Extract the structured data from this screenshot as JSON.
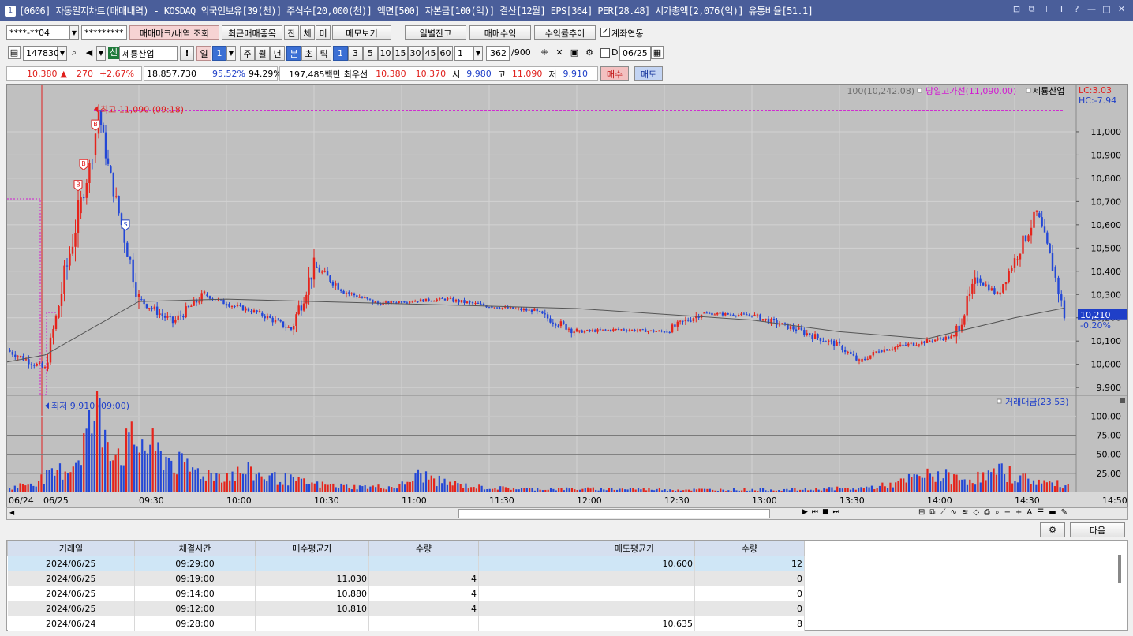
{
  "window": {
    "title": "[0606] 자동일지차트(매매내역) - KOSDAQ 외국인보유[39(천)] 주식수[20,000(천)] 액면[500] 자본금[100(억)] 결산[12월] EPS[364] PER[28.48] 시가총액[2,076(억)] 유통비율[51.1]",
    "icon_label": "1"
  },
  "toolbar1": {
    "account": "****-**04",
    "password": "*********",
    "trade_mark_btn": "매매마크/내역 조회",
    "recent_btn": "최근매매종목",
    "tab_jan": "잔",
    "tab_che": "체",
    "tab_mi": "미",
    "memo_btn": "메모보기",
    "daily_balance_btn": "일별잔고",
    "profit_btn": "매매수익",
    "profit_trend_btn": "수익률추이",
    "link_label": "계좌연동",
    "link_checked": "✓"
  },
  "toolbar2": {
    "code": "147830",
    "badge": "신",
    "stock_name": "제룡산업",
    "alert": "!",
    "period_day": "일",
    "period_num": "1",
    "period_week": "주",
    "period_month": "월",
    "period_year": "년",
    "period_min": "분",
    "period_sec": "초",
    "period_tick": "틱",
    "minute_options": [
      "1",
      "3",
      "5",
      "10",
      "15",
      "30",
      "45",
      "60"
    ],
    "interval_value": "1",
    "count": "362",
    "count_max": "/900",
    "date_check_label": "D",
    "date": "06/25"
  },
  "quote": {
    "price": "10,380",
    "arrow": "▲",
    "change": "270",
    "change_pct": "+2.67%",
    "volume": "18,857,730",
    "pct1": "95.52%",
    "pct2": "94.29%",
    "amount": "197,485백만",
    "best_label": "최우선",
    "best_ask": "10,380",
    "best_bid": "10,370",
    "open_label": "시",
    "open": "9,980",
    "high_label": "고",
    "high": "11,090",
    "low_label": "저",
    "low": "9,910",
    "buy_btn": "매수",
    "sell_btn": "매도"
  },
  "chart_data": {
    "type": "line",
    "title": "",
    "legend": {
      "ma": "100(10,242.08)",
      "high_line": "당일고가선(11,090.00)",
      "name": "제룡산업",
      "lc": "LC:3.03",
      "hc": "HC:-7.94"
    },
    "annotations": {
      "high": "최고 11,090 (09:18)",
      "low": "최저 9,910 (09:00)"
    },
    "trade_marks": [
      "B",
      "B",
      "B",
      "S"
    ],
    "current_price_tag": "10,210",
    "current_pct_tag": "-0.20%",
    "y_ticks": [
      "11,000",
      "10,900",
      "10,800",
      "10,700",
      "10,600",
      "10,500",
      "10,400",
      "10,300",
      "10,200",
      "10,100",
      "10,000",
      "9,900"
    ],
    "y_values": [
      11000,
      10900,
      10800,
      10700,
      10600,
      10500,
      10400,
      10300,
      10200,
      10100,
      10000,
      9900
    ],
    "ylim": [
      9870,
      11200
    ],
    "x_ticks": [
      "06/24",
      "06/25",
      "09:30",
      "10:00",
      "10:30",
      "11:00",
      "11:30",
      "12:00",
      "12:30",
      "13:00",
      "13:30",
      "14:00",
      "14:30",
      "14:50:00"
    ],
    "series": [
      {
        "name": "가격",
        "x": [
          "06/24",
          "06/25 09:00",
          "09:05",
          "09:10",
          "09:15",
          "09:18",
          "09:22",
          "09:25",
          "09:30",
          "09:40",
          "09:50",
          "10:00",
          "10:15",
          "10:25",
          "10:30",
          "10:40",
          "10:50",
          "11:00",
          "11:15",
          "11:30",
          "11:45",
          "12:00",
          "12:15",
          "12:30",
          "12:45",
          "13:00",
          "13:15",
          "13:30",
          "13:40",
          "13:50",
          "14:00",
          "14:10",
          "14:20",
          "14:25",
          "14:30",
          "14:35",
          "14:40",
          "14:45"
        ],
        "values": [
          10060,
          9980,
          10200,
          10650,
          10900,
          11090,
          10850,
          10600,
          10280,
          10180,
          10300,
          10260,
          10220,
          10150,
          10420,
          10310,
          10260,
          10270,
          10280,
          10250,
          10230,
          10140,
          10150,
          10140,
          10220,
          10210,
          10150,
          10080,
          10010,
          10060,
          10100,
          10120,
          10370,
          10300,
          10450,
          10650,
          10420,
          10210
        ]
      },
      {
        "name": "100",
        "x": [
          "06/24",
          "06/25 09:00",
          "09:30",
          "10:00",
          "11:00",
          "12:00",
          "13:00",
          "13:30",
          "14:00",
          "14:30",
          "14:45"
        ],
        "values": [
          10010,
          10040,
          10270,
          10280,
          10260,
          10240,
          10190,
          10140,
          10110,
          10200,
          10242
        ]
      }
    ],
    "volume": {
      "label": "거래대금(23.53)",
      "y_ticks": [
        "100.00",
        "75.00",
        "50.00",
        "25.00"
      ],
      "y_values": [
        100,
        75,
        50,
        25
      ],
      "ylim": [
        0,
        120
      ],
      "values": [
        6,
        14,
        25,
        42,
        115,
        60,
        75,
        55,
        38,
        28,
        25,
        30,
        22,
        18,
        12,
        10,
        8,
        8,
        8,
        26,
        15,
        10,
        7,
        6,
        5,
        5,
        5,
        5,
        5,
        5,
        5,
        4,
        4,
        4,
        4,
        4,
        4,
        4,
        6,
        5,
        8,
        12,
        22,
        26,
        18,
        22,
        30,
        20,
        14,
        10
      ]
    }
  },
  "nav": {
    "next_btn": "다음"
  },
  "table": {
    "headers": [
      "거래일",
      "체결시간",
      "매수평균가",
      "수량",
      "",
      "매도평균가",
      "수량"
    ],
    "rows": [
      [
        "2024/06/25",
        "09:29:00",
        "",
        "",
        "",
        "10,600",
        "12"
      ],
      [
        "2024/06/25",
        "09:19:00",
        "11,030",
        "4",
        "",
        "",
        "0"
      ],
      [
        "2024/06/25",
        "09:14:00",
        "10,880",
        "4",
        "",
        "",
        "0"
      ],
      [
        "2024/06/25",
        "09:12:00",
        "10,810",
        "4",
        "",
        "",
        "0"
      ],
      [
        "2024/06/24",
        "09:28:00",
        "",
        "",
        "",
        "10,635",
        "8"
      ]
    ]
  }
}
